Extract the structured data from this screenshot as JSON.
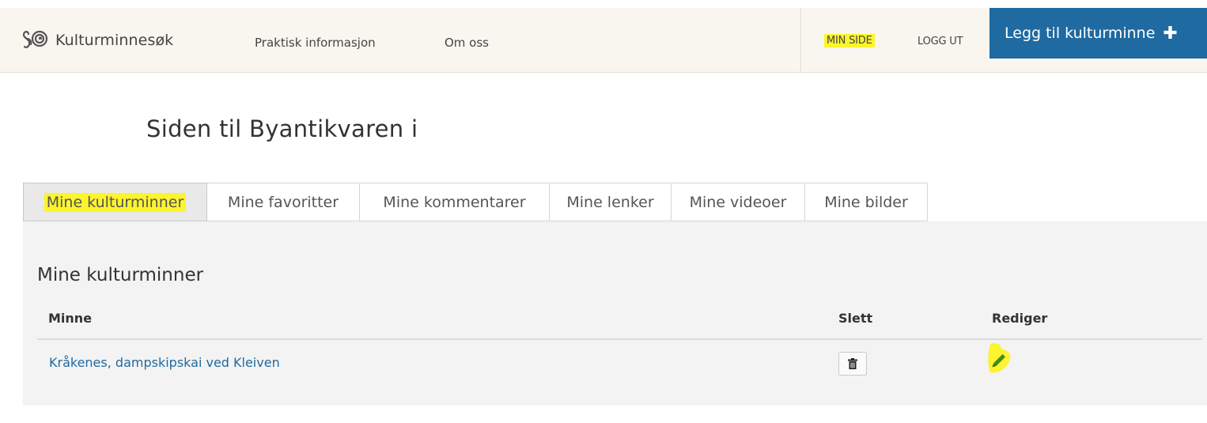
{
  "header": {
    "brand": "Kulturminnesøk",
    "nav": [
      "Praktisk informasjon",
      "Om oss"
    ],
    "min_side": "MIN SIDE",
    "logg_ut": "LOGG UT",
    "add_button": "Legg til kulturminne"
  },
  "page": {
    "title": "Siden til Byantikvaren i"
  },
  "tabs": [
    "Mine kulturminner",
    "Mine favoritter",
    "Mine kommentarer",
    "Mine lenker",
    "Mine videoer",
    "Mine bilder"
  ],
  "panel": {
    "title": "Mine kulturminner",
    "columns": [
      "Minne",
      "Slett",
      "Rediger"
    ],
    "rows": [
      {
        "minne": "Kråkenes, dampskipskai ved Kleiven"
      }
    ]
  },
  "colors": {
    "accent": "#1f6aa0",
    "highlight": "#fbf42e",
    "header_bg": "#f9f5ef",
    "panel_bg": "#f3f3f3"
  },
  "icons": {
    "logo": "logo-icon",
    "add": "plus-icon",
    "delete": "trash-icon",
    "edit": "pencil-icon"
  }
}
